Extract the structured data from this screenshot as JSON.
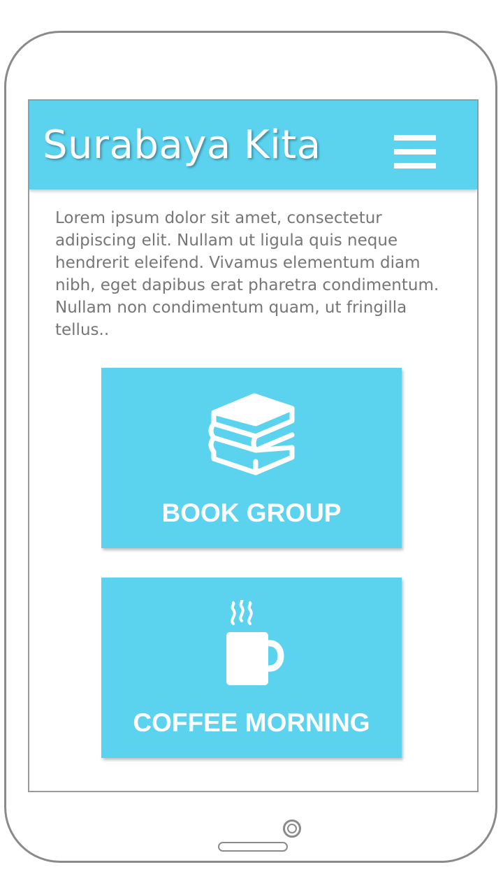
{
  "header": {
    "title": "Surabaya Kita",
    "menu_icon": "hamburger-menu-icon"
  },
  "intro": {
    "text": "Lorem ipsum dolor sit amet, consectetur adipiscing elit. Nullam ut ligula quis neque hendrerit eleifend. Vivamus elementum diam nibh, eget dapibus erat pharetra condimentum. Nullam non condimentum quam, ut fringilla tellus.."
  },
  "cards": [
    {
      "label": "BOOK GROUP",
      "icon": "books-icon"
    },
    {
      "label": "COFFEE MORNING",
      "icon": "coffee-mug-icon"
    }
  ],
  "colors": {
    "accent": "#5bd3ef",
    "text": "#767676",
    "device_frame": "#8a8a8a"
  }
}
